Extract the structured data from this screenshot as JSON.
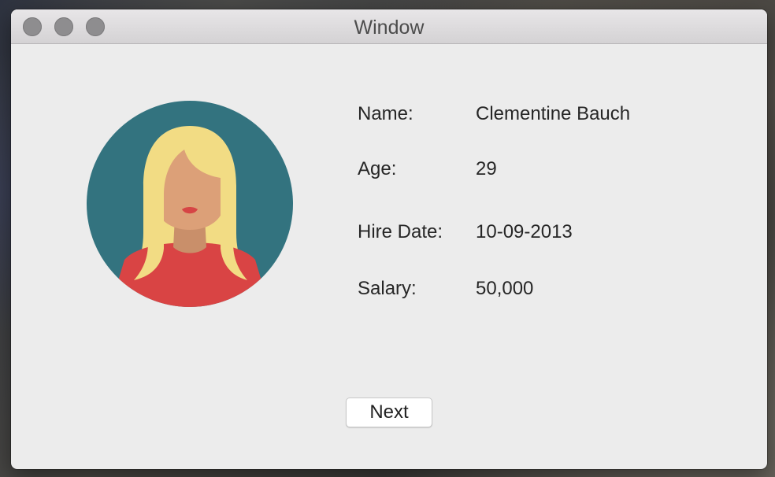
{
  "window": {
    "title": "Window"
  },
  "profile": {
    "avatar_icon": "female-avatar-icon",
    "fields": [
      {
        "label": "Name:",
        "value": "Clementine Bauch"
      },
      {
        "label": "Age:",
        "value": "29"
      },
      {
        "label": "Hire Date:",
        "value": "10-09-2013"
      },
      {
        "label": "Salary:",
        "value": "50,000"
      }
    ]
  },
  "actions": {
    "next_label": "Next"
  },
  "colors": {
    "window_background": "#ececec",
    "avatar_background": "#33737f",
    "avatar_hair": "#f2dc84",
    "avatar_skin": "#dca078",
    "avatar_shirt": "#d94444",
    "traffic_light_inactive": "#8e8d8f"
  }
}
